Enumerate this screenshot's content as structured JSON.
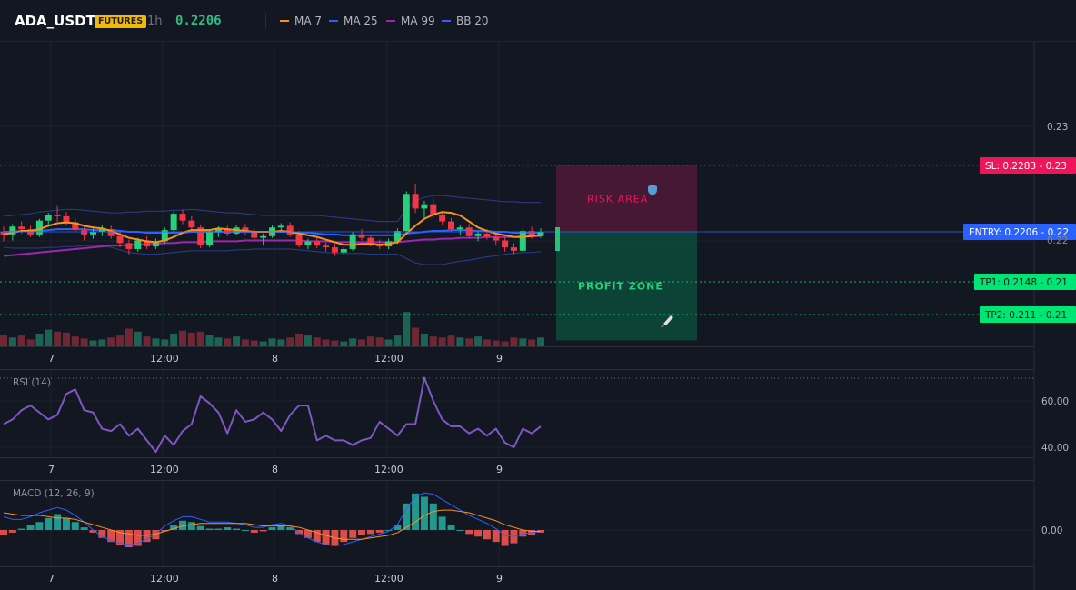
{
  "header": {
    "symbol": "ADA_USDT",
    "badge": "FUTURES",
    "timeframe": "1h",
    "last_price": "0.2206",
    "legend": [
      {
        "label": "MA 7",
        "color": "#f7931a"
      },
      {
        "label": "MA 25",
        "color": "#2962ff"
      },
      {
        "label": "MA 99",
        "color": "#9c27b0"
      },
      {
        "label": "BB 20",
        "color": "#3d5afe"
      }
    ]
  },
  "colors": {
    "up": "#26d07c",
    "down": "#f23645",
    "sl": "#f0145a",
    "entry": "#2962ff",
    "tp": "#00e676",
    "rsi": "#7e57c2"
  },
  "chart_data": [
    {
      "type": "candlestick",
      "title": "",
      "x_ticks": [
        "7",
        "12:00",
        "8",
        "12:00",
        "9"
      ],
      "y_ticks": [
        "0.23",
        "0.22"
      ],
      "series": [
        {
          "name": "MA 7"
        },
        {
          "name": "MA 25"
        },
        {
          "name": "MA 99"
        },
        {
          "name": "BB 20"
        }
      ],
      "ohlc": [
        [
          0.2206,
          0.2212,
          0.2195,
          0.2203
        ],
        [
          0.2203,
          0.2215,
          0.2196,
          0.2212
        ],
        [
          0.2212,
          0.2218,
          0.2204,
          0.2209
        ],
        [
          0.2209,
          0.2213,
          0.22,
          0.2203
        ],
        [
          0.2203,
          0.2221,
          0.22,
          0.2219
        ],
        [
          0.2219,
          0.2228,
          0.2212,
          0.2226
        ],
        [
          0.2226,
          0.2236,
          0.2218,
          0.2224
        ],
        [
          0.2224,
          0.2229,
          0.2213,
          0.2217
        ],
        [
          0.2217,
          0.2222,
          0.2205,
          0.2208
        ],
        [
          0.2208,
          0.2212,
          0.2196,
          0.2203
        ],
        [
          0.2203,
          0.221,
          0.2198,
          0.2206
        ],
        [
          0.2206,
          0.2214,
          0.2201,
          0.2209
        ],
        [
          0.2209,
          0.2213,
          0.2198,
          0.2201
        ],
        [
          0.2201,
          0.2206,
          0.2188,
          0.2193
        ],
        [
          0.2193,
          0.2197,
          0.218,
          0.2186
        ],
        [
          0.2186,
          0.2199,
          0.2183,
          0.2196
        ],
        [
          0.2196,
          0.2201,
          0.2186,
          0.2189
        ],
        [
          0.2189,
          0.2198,
          0.2186,
          0.2195
        ],
        [
          0.2195,
          0.2211,
          0.2192,
          0.2208
        ],
        [
          0.2208,
          0.223,
          0.2205,
          0.2227
        ],
        [
          0.2227,
          0.2232,
          0.2215,
          0.2219
        ],
        [
          0.2219,
          0.2224,
          0.2207,
          0.2211
        ],
        [
          0.2211,
          0.2214,
          0.2187,
          0.2191
        ],
        [
          0.2191,
          0.2209,
          0.2188,
          0.2206
        ],
        [
          0.2206,
          0.2212,
          0.22,
          0.2209
        ],
        [
          0.2209,
          0.2213,
          0.2201,
          0.2204
        ],
        [
          0.2204,
          0.2214,
          0.2202,
          0.2211
        ],
        [
          0.2211,
          0.2215,
          0.2203,
          0.2206
        ],
        [
          0.2206,
          0.221,
          0.2196,
          0.2199
        ],
        [
          0.2199,
          0.2204,
          0.219,
          0.2201
        ],
        [
          0.2201,
          0.2214,
          0.2199,
          0.2211
        ],
        [
          0.2211,
          0.2216,
          0.2205,
          0.2213
        ],
        [
          0.2213,
          0.2217,
          0.22,
          0.2203
        ],
        [
          0.2203,
          0.2207,
          0.2188,
          0.2191
        ],
        [
          0.2191,
          0.2198,
          0.2186,
          0.2195
        ],
        [
          0.2195,
          0.2199,
          0.2187,
          0.219
        ],
        [
          0.219,
          0.2194,
          0.2183,
          0.2188
        ],
        [
          0.2188,
          0.2192,
          0.2178,
          0.2182
        ],
        [
          0.2182,
          0.2189,
          0.2179,
          0.2186
        ],
        [
          0.2186,
          0.2206,
          0.2184,
          0.2203
        ],
        [
          0.2203,
          0.2209,
          0.2196,
          0.2199
        ],
        [
          0.2199,
          0.2202,
          0.2189,
          0.2192
        ],
        [
          0.2192,
          0.2197,
          0.2186,
          0.2189
        ],
        [
          0.2189,
          0.2198,
          0.2186,
          0.2195
        ],
        [
          0.2195,
          0.221,
          0.2192,
          0.2207
        ],
        [
          0.2207,
          0.2253,
          0.2205,
          0.225
        ],
        [
          0.225,
          0.2262,
          0.2228,
          0.2233
        ],
        [
          0.2233,
          0.2242,
          0.2222,
          0.2238
        ],
        [
          0.2238,
          0.2244,
          0.2222,
          0.2226
        ],
        [
          0.2226,
          0.223,
          0.2214,
          0.2218
        ],
        [
          0.2218,
          0.2222,
          0.2206,
          0.2209
        ],
        [
          0.2209,
          0.2214,
          0.2203,
          0.2211
        ],
        [
          0.2211,
          0.2215,
          0.2198,
          0.2201
        ],
        [
          0.2201,
          0.2207,
          0.2195,
          0.2204
        ],
        [
          0.2204,
          0.2209,
          0.2197,
          0.22
        ],
        [
          0.22,
          0.2205,
          0.2191,
          0.2196
        ],
        [
          0.2196,
          0.22,
          0.2183,
          0.2188
        ],
        [
          0.2188,
          0.2193,
          0.218,
          0.2184
        ],
        [
          0.2184,
          0.221,
          0.2183,
          0.2207
        ],
        [
          0.2207,
          0.2212,
          0.2198,
          0.2201
        ],
        [
          0.2201,
          0.221,
          0.2199,
          0.2206
        ]
      ],
      "volume": [
        24,
        18,
        22,
        14,
        26,
        34,
        30,
        28,
        20,
        16,
        12,
        14,
        18,
        22,
        36,
        30,
        20,
        16,
        14,
        26,
        32,
        28,
        30,
        24,
        18,
        16,
        20,
        14,
        12,
        10,
        16,
        14,
        18,
        26,
        22,
        18,
        14,
        12,
        10,
        16,
        14,
        20,
        18,
        14,
        22,
        70,
        38,
        26,
        20,
        18,
        22,
        18,
        16,
        20,
        14,
        12,
        10,
        18,
        16,
        14,
        18
      ],
      "ma7": [
        0.2203,
        0.2205,
        0.2207,
        0.2207,
        0.2209,
        0.2213,
        0.2216,
        0.2217,
        0.2216,
        0.2213,
        0.2211,
        0.221,
        0.2207,
        0.2203,
        0.2199,
        0.2197,
        0.2195,
        0.2194,
        0.2196,
        0.22,
        0.2205,
        0.2208,
        0.2208,
        0.2208,
        0.221,
        0.2209,
        0.2208,
        0.2207,
        0.2206,
        0.2206,
        0.2206,
        0.2207,
        0.2206,
        0.2204,
        0.2202,
        0.22,
        0.2197,
        0.2194,
        0.2191,
        0.2191,
        0.2192,
        0.2192,
        0.2191,
        0.2192,
        0.2194,
        0.2204,
        0.2213,
        0.2221,
        0.2226,
        0.2229,
        0.2228,
        0.2225,
        0.2218,
        0.2211,
        0.2207,
        0.2204,
        0.2202,
        0.22,
        0.22,
        0.2201,
        0.2202
      ],
      "ma25": [
        0.2206,
        0.2206,
        0.2207,
        0.2207,
        0.2207,
        0.2208,
        0.2209,
        0.2209,
        0.2209,
        0.2209,
        0.2208,
        0.2208,
        0.2208,
        0.2207,
        0.2206,
        0.2206,
        0.2205,
        0.2205,
        0.2205,
        0.2205,
        0.2205,
        0.2206,
        0.2206,
        0.2206,
        0.2206,
        0.2206,
        0.2206,
        0.2206,
        0.2206,
        0.2206,
        0.2206,
        0.2206,
        0.2206,
        0.2205,
        0.2205,
        0.2204,
        0.2203,
        0.2203,
        0.2202,
        0.2202,
        0.2202,
        0.2202,
        0.2202,
        0.2202,
        0.2202,
        0.2204,
        0.2205,
        0.2206,
        0.2207,
        0.2207,
        0.2208,
        0.2208,
        0.2208,
        0.2207,
        0.2207,
        0.2206,
        0.2206,
        0.2205,
        0.2205,
        0.2205,
        0.2205
      ],
      "ma99": [
        0.2178,
        0.2179,
        0.218,
        0.2181,
        0.2182,
        0.2183,
        0.2184,
        0.2185,
        0.2186,
        0.2187,
        0.2188,
        0.2189,
        0.219,
        0.219,
        0.2191,
        0.2191,
        0.2192,
        0.2192,
        0.2193,
        0.2193,
        0.2194,
        0.2194,
        0.2194,
        0.2195,
        0.2195,
        0.2195,
        0.2195,
        0.2196,
        0.2196,
        0.2196,
        0.2196,
        0.2196,
        0.2196,
        0.2196,
        0.2195,
        0.2195,
        0.2195,
        0.2194,
        0.2194,
        0.2194,
        0.2194,
        0.2194,
        0.2194,
        0.2194,
        0.2194,
        0.2195,
        0.2196,
        0.2197,
        0.2197,
        0.2198,
        0.2198,
        0.2199,
        0.2199,
        0.2199,
        0.22,
        0.22,
        0.22,
        0.22,
        0.2201,
        0.2201,
        0.2201
      ],
      "bb_upper": [
        0.2224,
        0.2225,
        0.2226,
        0.2227,
        0.2229,
        0.223,
        0.2231,
        0.2232,
        0.2232,
        0.2231,
        0.223,
        0.2229,
        0.2228,
        0.2228,
        0.2229,
        0.2229,
        0.223,
        0.223,
        0.223,
        0.2231,
        0.2231,
        0.2232,
        0.2231,
        0.223,
        0.2229,
        0.2228,
        0.2228,
        0.2227,
        0.2226,
        0.2225,
        0.2225,
        0.2225,
        0.2225,
        0.2225,
        0.2225,
        0.2225,
        0.2224,
        0.2223,
        0.2222,
        0.2221,
        0.222,
        0.2219,
        0.2218,
        0.2218,
        0.2218,
        0.2232,
        0.2242,
        0.2246,
        0.2248,
        0.2248,
        0.2247,
        0.2246,
        0.2245,
        0.2244,
        0.2243,
        0.2242,
        0.2241,
        0.2241,
        0.224,
        0.224,
        0.224
      ],
      "bb_lower": [
        0.2188,
        0.2187,
        0.2187,
        0.2187,
        0.2187,
        0.2188,
        0.2188,
        0.2189,
        0.2189,
        0.219,
        0.219,
        0.219,
        0.2188,
        0.2185,
        0.2182,
        0.2181,
        0.218,
        0.218,
        0.2181,
        0.2182,
        0.2183,
        0.2184,
        0.2184,
        0.2184,
        0.2184,
        0.2184,
        0.2185,
        0.2185,
        0.2186,
        0.2186,
        0.2186,
        0.2186,
        0.2186,
        0.2185,
        0.2184,
        0.2183,
        0.2182,
        0.2181,
        0.2181,
        0.2181,
        0.2181,
        0.218,
        0.218,
        0.218,
        0.218,
        0.2175,
        0.217,
        0.2168,
        0.2168,
        0.2168,
        0.217,
        0.2172,
        0.2173,
        0.2175,
        0.2177,
        0.2178,
        0.218,
        0.2181,
        0.2182,
        0.2182,
        0.2183
      ],
      "levels": [
        {
          "name": "SL",
          "label": "SL: 0.2283",
          "price": 0.2283,
          "axis_text": "0.23"
        },
        {
          "name": "ENTRY",
          "label": "ENTRY: 0.2206",
          "price": 0.2206,
          "axis_text": "0.22"
        },
        {
          "name": "TP1",
          "label": "TP1: 0.2148",
          "price": 0.2148,
          "axis_text": "0.21"
        },
        {
          "name": "TP2",
          "label": "TP2: 0.211",
          "price": 0.211,
          "axis_text": "0.21"
        }
      ],
      "zones": [
        {
          "label": "RISK AREA",
          "icon": "shield-icon",
          "from": 0.2206,
          "to": 0.2283
        },
        {
          "label": "PROFIT ZONE",
          "icon": "rocket-icon",
          "from": 0.208,
          "to": 0.2206
        }
      ]
    },
    {
      "type": "line",
      "title": "RSI (14)",
      "x_ticks": [
        "7",
        "12:00",
        "8",
        "12:00",
        "9"
      ],
      "y_ticks": [
        "60.00",
        "40.00"
      ],
      "ylim": [
        36,
        73
      ],
      "values": [
        50,
        52,
        56,
        58,
        55,
        52,
        54,
        63,
        65,
        56,
        55,
        48,
        47,
        50,
        45,
        48,
        43,
        38,
        45,
        41,
        47,
        50,
        62,
        59,
        55,
        46,
        56,
        51,
        52,
        55,
        52,
        47,
        54,
        58,
        58,
        43,
        45,
        43,
        43,
        41,
        43,
        44,
        51,
        48,
        45,
        50,
        50,
        70,
        60,
        52,
        49,
        49,
        46,
        48,
        45,
        48,
        42,
        40,
        48,
        46,
        49
      ]
    },
    {
      "type": "bar",
      "title": "MACD (12, 26, 9)",
      "x_ticks": [
        "7",
        "12:00",
        "8",
        "12:00",
        "9"
      ],
      "y_ticks": [
        "0.00"
      ],
      "ylim": [
        -0.00065,
        0.00085
      ],
      "histogram": [
        -8e-05,
        -4e-05,
        2e-05,
        8e-05,
        0.00012,
        0.00018,
        0.00024,
        0.00018,
        0.00012,
        4e-05,
        -4e-05,
        -0.00012,
        -0.00018,
        -0.00022,
        -0.00026,
        -0.00024,
        -0.00018,
        -0.00014,
        -2e-05,
        8e-05,
        0.00014,
        0.00012,
        6e-05,
        2e-05,
        2e-05,
        4e-05,
        2e-05,
        0.0,
        -4e-05,
        -2e-05,
        4e-05,
        8e-05,
        4e-05,
        -6e-05,
        -0.00012,
        -0.00018,
        -0.00022,
        -0.00022,
        -0.00018,
        -0.00012,
        -8e-05,
        -6e-05,
        -4e-05,
        0.0,
        8e-05,
        0.0004,
        0.00055,
        0.0005,
        0.0004,
        0.0002,
        8e-05,
        0.0,
        -6e-05,
        -0.0001,
        -0.00014,
        -0.00018,
        -0.00024,
        -0.0002,
        -0.0001,
        -8e-05,
        -4e-05
      ],
      "macd": [
        0.0002,
        0.00016,
        0.00016,
        0.0002,
        0.00026,
        0.0003,
        0.00034,
        0.0003,
        0.00022,
        0.00012,
        0.0,
        -0.0001,
        -0.00016,
        -0.0002,
        -0.00022,
        -0.0002,
        -0.00014,
        -6e-05,
        6e-05,
        0.00014,
        0.0002,
        0.0002,
        0.00016,
        0.00012,
        0.00012,
        0.00012,
        0.0001,
        8e-05,
        4e-05,
        4e-05,
        8e-05,
        0.0001,
        6e-05,
        -4e-05,
        -0.00012,
        -0.00018,
        -0.00022,
        -0.00024,
        -0.00022,
        -0.00018,
        -0.00014,
        -0.0001,
        -6e-05,
        -2e-05,
        8e-05,
        0.00032,
        0.0005,
        0.00056,
        0.00054,
        0.00046,
        0.00038,
        0.0003,
        0.00022,
        0.00016,
        0.0001,
        2e-05,
        -8e-05,
        -0.0001,
        -6e-05,
        -4e-05,
        -2e-05
      ],
      "signal": [
        0.00026,
        0.00024,
        0.00022,
        0.00022,
        0.00022,
        0.0002,
        0.00018,
        0.00018,
        0.00016,
        0.00012,
        8e-05,
        4e-05,
        0.0,
        -4e-05,
        -6e-05,
        -8e-05,
        -8e-05,
        -6e-05,
        -2e-05,
        2e-05,
        6e-05,
        8e-05,
        0.0001,
        0.0001,
        0.0001,
        0.0001,
        0.0001,
        0.0001,
        8e-05,
        6e-05,
        6e-05,
        6e-05,
        6e-05,
        4e-05,
        0.0,
        -4e-05,
        -8e-05,
        -0.00012,
        -0.00014,
        -0.00014,
        -0.00014,
        -0.00012,
        -0.0001,
        -8e-05,
        -4e-05,
        4e-05,
        0.00012,
        0.00022,
        0.00028,
        0.0003,
        0.0003,
        0.00028,
        0.00026,
        0.00022,
        0.00018,
        0.00014,
        8e-05,
        4e-05,
        0.0,
        -2e-05,
        -2e-05
      ]
    }
  ]
}
